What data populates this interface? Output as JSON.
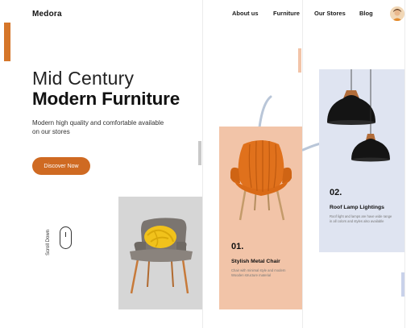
{
  "brand": {
    "name": "Medora"
  },
  "nav": {
    "items": [
      {
        "label": "About us"
      },
      {
        "label": "Furniture"
      },
      {
        "label": "Our Stores"
      },
      {
        "label": "Blog"
      }
    ]
  },
  "hero": {
    "title_line1": "Mid Century",
    "title_line2": "Modern Furniture",
    "subtitle": "Modern high quality and comfortable available on our stores",
    "cta_label": "Discover Now",
    "scroll_label": "Scroll Down"
  },
  "products": [
    {
      "number": "01.",
      "title": "Stylish Metal Chair",
      "description": "Chair with minimal style and modern Wooden structure material",
      "color": "#f2c4a8"
    },
    {
      "number": "02.",
      "title": "Roof Lamp Lightings",
      "description": "Roof light and lamps are have wide range in all colors and styles also available",
      "color": "#dfe4f1"
    }
  ],
  "colors": {
    "accent": "#d5762a",
    "button": "#cf6a22",
    "gray_card": "#d6d6d6"
  },
  "icons": [
    "mouse-icon",
    "user-avatar"
  ]
}
